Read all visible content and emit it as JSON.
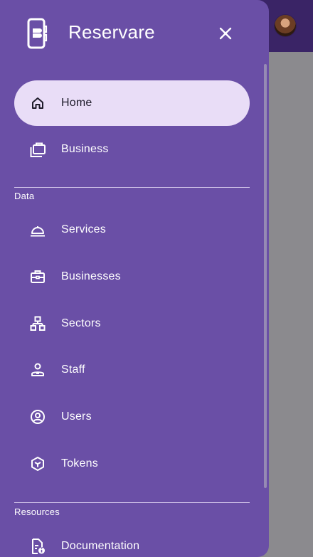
{
  "app": {
    "title": "Reservare"
  },
  "drawer": {
    "close_icon": "close-icon",
    "primary": [
      {
        "label": "Home",
        "icon": "home-icon",
        "active": true
      },
      {
        "label": "Business",
        "icon": "business-icon",
        "active": false
      }
    ],
    "sections": [
      {
        "title": "Data",
        "items": [
          {
            "label": "Services",
            "icon": "room-service-icon"
          },
          {
            "label": "Businesses",
            "icon": "briefcase-icon"
          },
          {
            "label": "Sectors",
            "icon": "hierarchy-icon"
          },
          {
            "label": "Staff",
            "icon": "staff-icon"
          },
          {
            "label": "Users",
            "icon": "user-circle-icon"
          },
          {
            "label": "Tokens",
            "icon": "token-icon"
          }
        ]
      },
      {
        "title": "Resources",
        "items": [
          {
            "label": "Documentation",
            "icon": "document-info-icon"
          }
        ]
      }
    ]
  },
  "colors": {
    "drawer": "#6a4fa6",
    "active_pill": "#e9ddf7",
    "topbar": "#3a2466",
    "scrim": "#8b8a8e"
  }
}
